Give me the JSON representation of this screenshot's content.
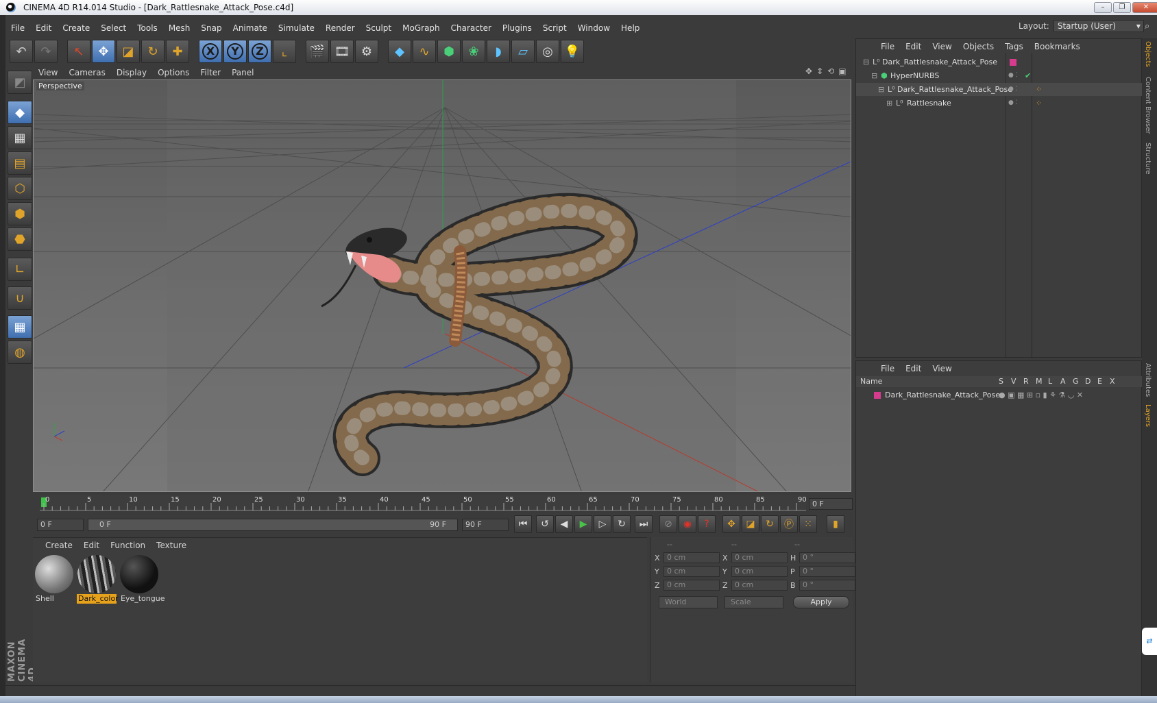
{
  "window": {
    "title": "CINEMA 4D R14.014 Studio - [Dark_Rattlesnake_Attack_Pose.c4d]",
    "buttons": [
      "–",
      "❐",
      "✕"
    ]
  },
  "menubar": [
    "File",
    "Edit",
    "Create",
    "Select",
    "Tools",
    "Mesh",
    "Snap",
    "Animate",
    "Simulate",
    "Render",
    "Sculpt",
    "MoGraph",
    "Character",
    "Plugins",
    "Script",
    "Window",
    "Help"
  ],
  "layout": {
    "label": "Layout:",
    "value": "Startup (User)"
  },
  "viewport": {
    "menu": [
      "View",
      "Cameras",
      "Display",
      "Options",
      "Filter",
      "Panel"
    ],
    "label": "Perspective"
  },
  "timeline": {
    "ticks": [
      "0",
      "5",
      "10",
      "15",
      "20",
      "25",
      "30",
      "35",
      "40",
      "45",
      "50",
      "55",
      "60",
      "65",
      "70",
      "75",
      "80",
      "85",
      "90"
    ],
    "current_frame": "0 F",
    "start_field": "0 F",
    "range_start": "0 F",
    "range_end": "90 F",
    "end_field": "90 F"
  },
  "materials": {
    "menu": [
      "Create",
      "Edit",
      "Function",
      "Texture"
    ],
    "items": [
      {
        "name": "Shell",
        "selected": false
      },
      {
        "name": "Dark_color",
        "selected": true
      },
      {
        "name": "Eye_tongue",
        "selected": false
      }
    ]
  },
  "coords": {
    "headers": [
      "--",
      "--",
      "--"
    ],
    "rows": [
      {
        "a": "X",
        "av": "0 cm",
        "b": "X",
        "bv": "0 cm",
        "c": "H",
        "cv": "0 °"
      },
      {
        "a": "Y",
        "av": "0 cm",
        "b": "Y",
        "bv": "0 cm",
        "c": "P",
        "cv": "0 °"
      },
      {
        "a": "Z",
        "av": "0 cm",
        "b": "Z",
        "bv": "0 cm",
        "c": "B",
        "cv": "0 °"
      }
    ],
    "mode": "World",
    "type": "Scale",
    "apply": "Apply"
  },
  "objects": {
    "menu": [
      "File",
      "Edit",
      "View",
      "Objects",
      "Tags",
      "Bookmarks"
    ],
    "tree": [
      {
        "name": "Dark_Rattlesnake_Attack_Pose"
      },
      {
        "name": "HyperNURBS"
      },
      {
        "name": "Dark_Rattlesnake_Attack_Pose"
      },
      {
        "name": "Rattlesnake"
      }
    ]
  },
  "layers": {
    "menu": [
      "File",
      "Edit",
      "View"
    ],
    "header": {
      "name": "Name",
      "cols": [
        "S",
        "V",
        "R",
        "M",
        "L",
        "A",
        "G",
        "D",
        "E",
        "X"
      ]
    },
    "rows": [
      {
        "name": "Dark_Rattlesnake_Attack_Pose"
      }
    ]
  },
  "sidetabs": [
    "Objects",
    "Content Browser",
    "Structure",
    "Attributes",
    "Layers"
  ],
  "logo": "MAXON CINEMA 4D",
  "colors": {
    "accent": "#e7a21c",
    "layer_color": "#d63b8e",
    "axis_x": "#c0392b",
    "axis_y": "#27ae60",
    "axis_z": "#2c3ec8"
  }
}
